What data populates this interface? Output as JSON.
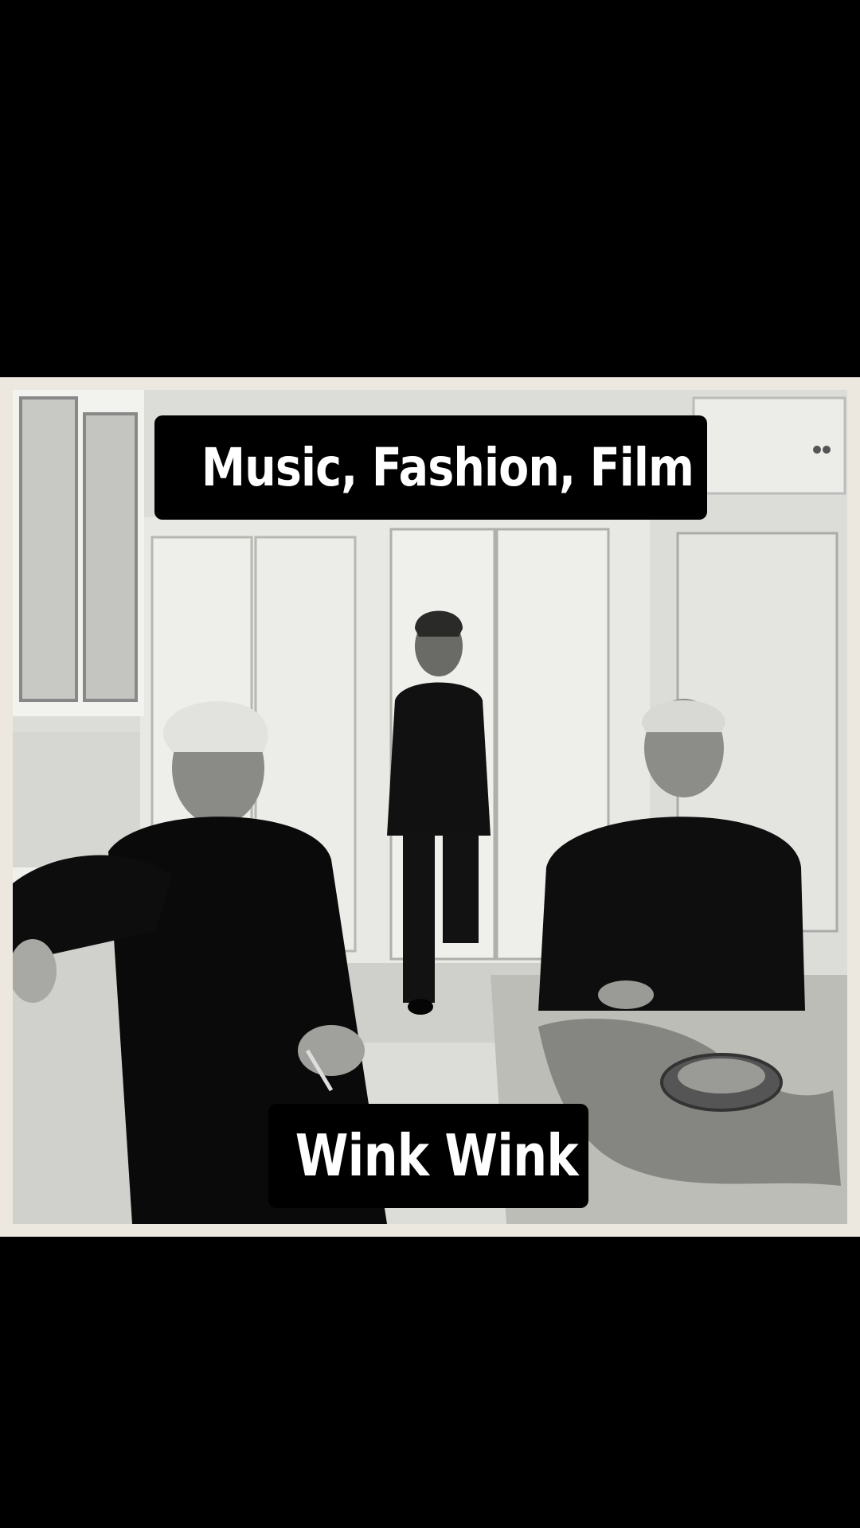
{
  "captions": {
    "top": "Music, Fashion, Film",
    "bottom": "Wink Wink"
  },
  "photo": {
    "description_icon": "black-and-white-photo-three-men-in-kitchen",
    "colors": {
      "frame": "#ece8df",
      "caption_bg": "#000000",
      "caption_text": "#ffffff"
    }
  }
}
